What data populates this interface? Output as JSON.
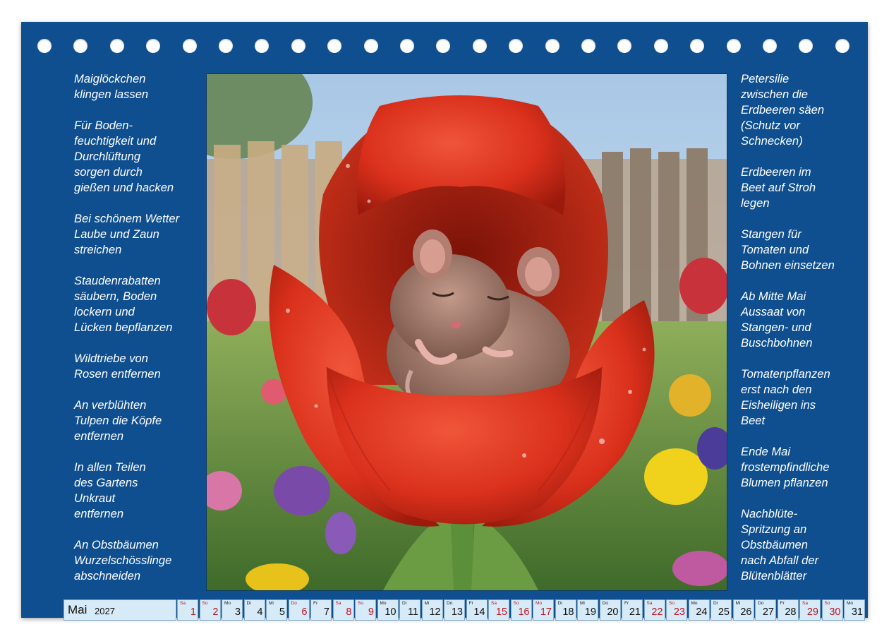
{
  "tips_left": [
    "Maiglöckchen\nklingen lassen",
    "Für Boden-\nfeuchtigkeit und\nDurchlüftung\nsorgen durch\ngießen und hacken",
    "Bei schönem Wetter\nLaube und Zaun\nstreichen",
    "Staudenrabatten\nsäubern, Boden\nlockern und\nLücken bepflanzen",
    "Wildtriebe von\nRosen entfernen",
    "An verblühten\nTulpen die Köpfe\nentfernen",
    "In allen Teilen\ndes Gartens\nUnkraut\nentfernen",
    "An Obstbäumen\nWurzelschösslinge\nabschneiden"
  ],
  "tips_right": [
    "Petersilie\nzwischen die\nErdbeeren säen\n(Schutz vor\nSchnecken)",
    "Erdbeeren im\nBeet auf Stroh\nlegen",
    "Stangen für\nTomaten und\nBohnen einsetzen",
    "Ab Mitte Mai\nAussaat von\nStangen- und\nBuschbohnen",
    "Tomatenpflanzen\nerst nach den\nEisheiligen ins\nBeet",
    "Ende Mai\nfrostempfindliche\nBlumen pflanzen",
    "Nachblüte-\nSpritzung an\nObstbäumen\nnach Abfall der\nBlütenblätter"
  ],
  "month": {
    "name": "Mai",
    "year": "2027"
  },
  "days": [
    {
      "wd": "Sa",
      "d": "1",
      "red": true
    },
    {
      "wd": "So",
      "d": "2",
      "red": true
    },
    {
      "wd": "Mo",
      "d": "3",
      "red": false
    },
    {
      "wd": "Di",
      "d": "4",
      "red": false
    },
    {
      "wd": "Mi",
      "d": "5",
      "red": false
    },
    {
      "wd": "Do",
      "d": "6",
      "red": true
    },
    {
      "wd": "Fr",
      "d": "7",
      "red": false
    },
    {
      "wd": "Sa",
      "d": "8",
      "red": true
    },
    {
      "wd": "So",
      "d": "9",
      "red": true
    },
    {
      "wd": "Mo",
      "d": "10",
      "red": false
    },
    {
      "wd": "Di",
      "d": "11",
      "red": false
    },
    {
      "wd": "Mi",
      "d": "12",
      "red": false
    },
    {
      "wd": "Do",
      "d": "13",
      "red": false
    },
    {
      "wd": "Fr",
      "d": "14",
      "red": false
    },
    {
      "wd": "Sa",
      "d": "15",
      "red": true
    },
    {
      "wd": "So",
      "d": "16",
      "red": true
    },
    {
      "wd": "Mo",
      "d": "17",
      "red": true
    },
    {
      "wd": "Di",
      "d": "18",
      "red": false
    },
    {
      "wd": "Mi",
      "d": "19",
      "red": false
    },
    {
      "wd": "Do",
      "d": "20",
      "red": false
    },
    {
      "wd": "Fr",
      "d": "21",
      "red": false
    },
    {
      "wd": "Sa",
      "d": "22",
      "red": true
    },
    {
      "wd": "So",
      "d": "23",
      "red": true
    },
    {
      "wd": "Mo",
      "d": "24",
      "red": false
    },
    {
      "wd": "Di",
      "d": "25",
      "red": false
    },
    {
      "wd": "Mi",
      "d": "26",
      "red": false
    },
    {
      "wd": "Do",
      "d": "27",
      "red": false
    },
    {
      "wd": "Fr",
      "d": "28",
      "red": false
    },
    {
      "wd": "Sa",
      "d": "29",
      "red": true
    },
    {
      "wd": "So",
      "d": "30",
      "red": true
    },
    {
      "wd": "Mo",
      "d": "31",
      "red": false
    }
  ],
  "colors": {
    "page_background": "#0f4f8f",
    "day_cell": "#d6eaf7",
    "holiday_red": "#c1121f",
    "tulip": "#d9301c"
  }
}
